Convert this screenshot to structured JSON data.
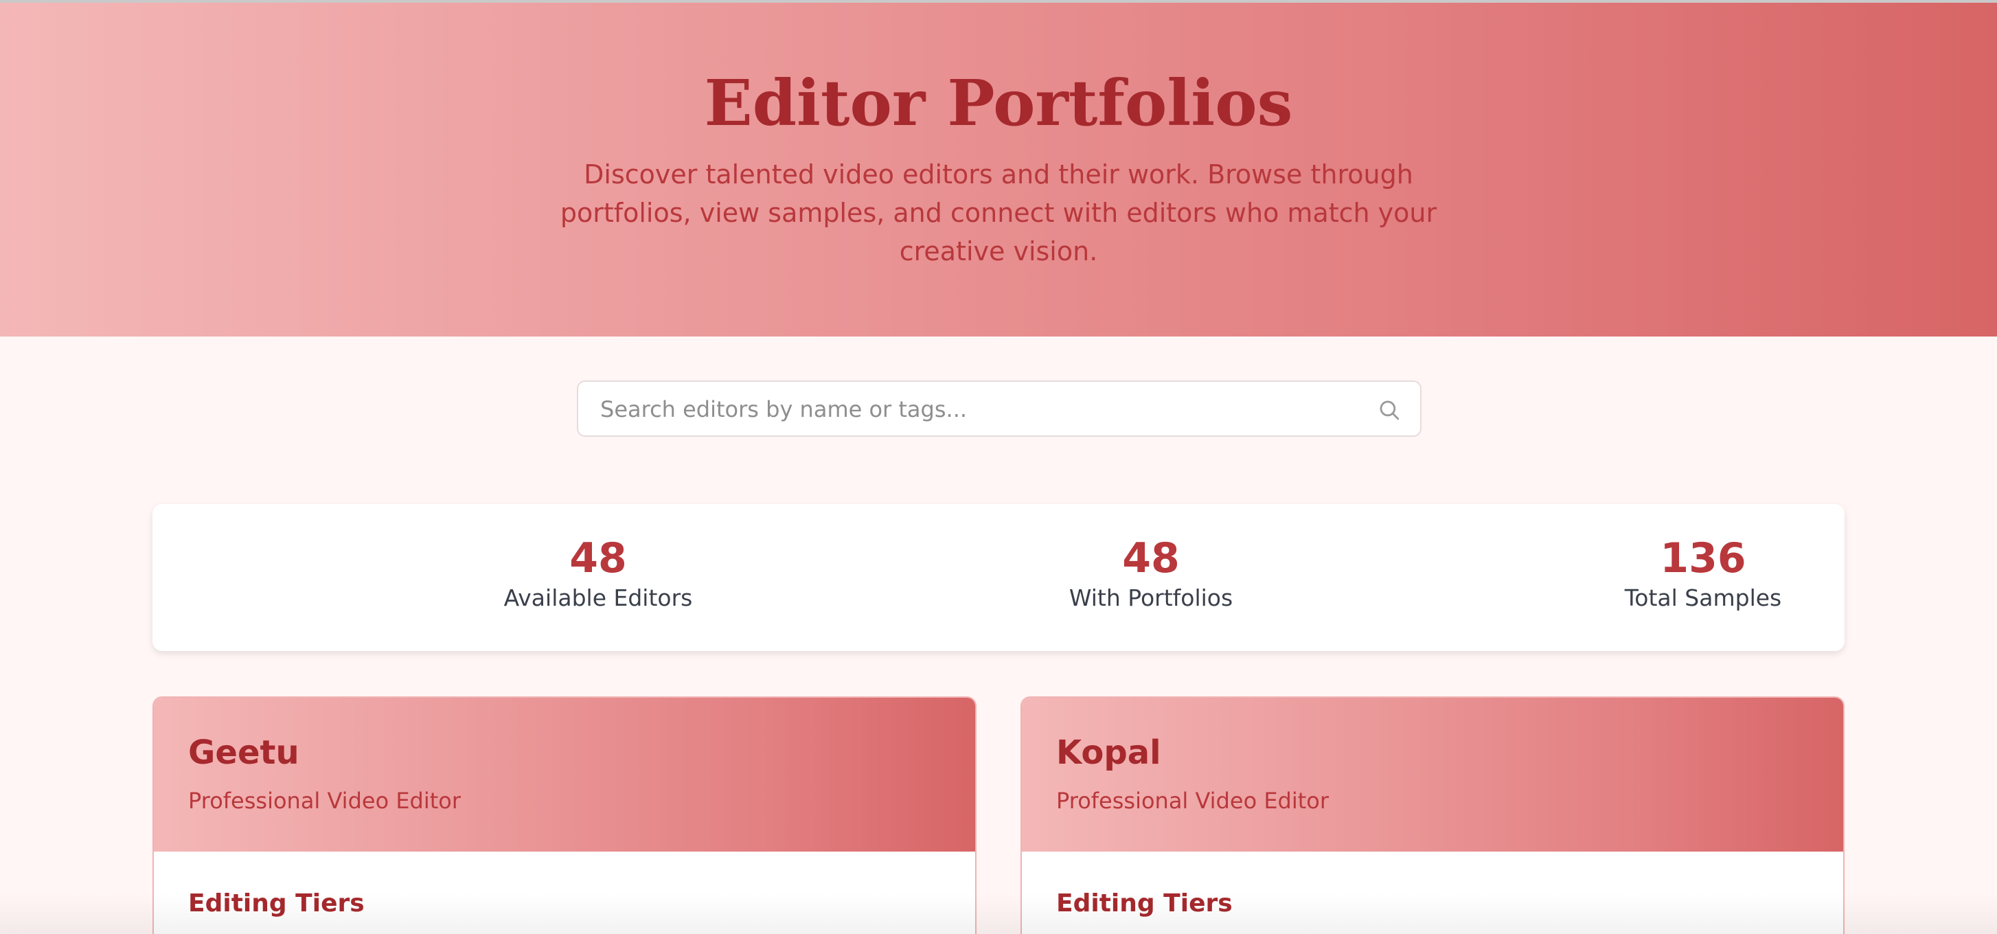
{
  "hero": {
    "title": "Editor Portfolios",
    "subtitle": "Discover talented video editors and their work. Browse through portfolios, view samples, and connect with editors who match your creative vision."
  },
  "search": {
    "placeholder": "Search editors by name or tags...",
    "value": "",
    "icon": "search-icon"
  },
  "stats": [
    {
      "value": "48",
      "label": "Available Editors"
    },
    {
      "value": "48",
      "label": "With Portfolios"
    },
    {
      "value": "136",
      "label": "Total Samples"
    }
  ],
  "editors": [
    {
      "name": "Geetu",
      "role": "Professional Video Editor",
      "section": "Editing Tiers"
    },
    {
      "name": "Kopal",
      "role": "Professional Video Editor",
      "section": "Editing Tiers"
    }
  ],
  "colors": {
    "accent": "#a6292d",
    "accent_light": "#b8383c",
    "gradient_start": "#f4b7b7",
    "gradient_end": "#d76566",
    "page_background": "#fff6f5"
  }
}
